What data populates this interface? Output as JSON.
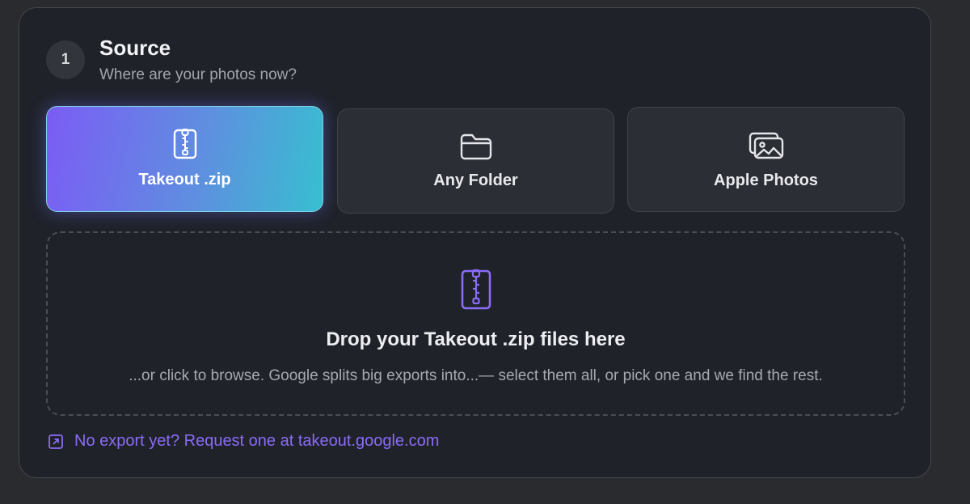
{
  "step": {
    "number": "1",
    "title": "Source",
    "subtitle": "Where are your photos now?"
  },
  "options": [
    {
      "label": "Takeout .zip",
      "icon": "zip-file-icon",
      "selected": true
    },
    {
      "label": "Any Folder",
      "icon": "folder-icon",
      "selected": false
    },
    {
      "label": "Apple Photos",
      "icon": "photos-icon",
      "selected": false
    }
  ],
  "dropzone": {
    "icon": "zip-file-icon",
    "title": "Drop your Takeout .zip files here",
    "subtitle": "...or click to browse. Google splits big exports into...— select them all, or pick one and we find the rest."
  },
  "help_link": {
    "icon": "external-link-icon",
    "text": "No export yet? Request one at takeout.google.com"
  },
  "colors": {
    "accent": "#8b6cf6",
    "selected_gradient_start": "#7b5cf5",
    "selected_gradient_end": "#37bfd0",
    "card_background": "#1f2229"
  }
}
